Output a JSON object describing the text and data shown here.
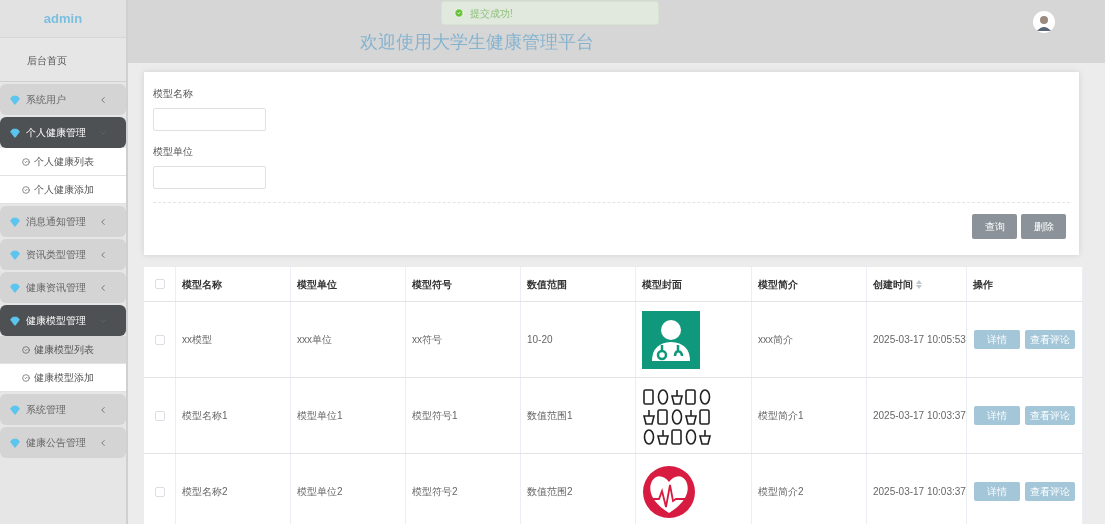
{
  "sidebar": {
    "brand": "admin",
    "home": "后台首页",
    "menus": [
      {
        "label": "系统用户",
        "expanded": false
      },
      {
        "label": "个人健康管理",
        "expanded": true,
        "children": [
          {
            "label": "个人健康列表",
            "selected": false
          },
          {
            "label": "个人健康添加",
            "selected": false
          }
        ]
      },
      {
        "label": "消息通知管理",
        "expanded": false
      },
      {
        "label": "资讯类型管理",
        "expanded": false
      },
      {
        "label": "健康资讯管理",
        "expanded": false
      },
      {
        "label": "健康模型管理",
        "expanded": true,
        "children": [
          {
            "label": "健康模型列表",
            "selected": true
          },
          {
            "label": "健康模型添加",
            "selected": false
          }
        ]
      },
      {
        "label": "系统管理",
        "expanded": false
      },
      {
        "label": "健康公告管理",
        "expanded": false
      }
    ]
  },
  "header": {
    "title": "欢迎使用大学生健康管理平台"
  },
  "toast": {
    "message": "提交成功!"
  },
  "search": {
    "fields": [
      {
        "label": "模型名称"
      },
      {
        "label": "模型单位"
      }
    ],
    "buttons": [
      "查询",
      "删除"
    ]
  },
  "table": {
    "all_checked": false,
    "columns": [
      {
        "label": "模型名称",
        "sortable": false
      },
      {
        "label": "模型单位",
        "sortable": false
      },
      {
        "label": "模型符号",
        "sortable": false
      },
      {
        "label": "数值范围",
        "sortable": false
      },
      {
        "label": "模型封面",
        "sortable": false
      },
      {
        "label": "模型简介",
        "sortable": false
      },
      {
        "label": "创建时间",
        "sortable": true
      },
      {
        "label": "操作",
        "sortable": false
      }
    ],
    "rows": [
      {
        "checked": false,
        "name": "xx模型",
        "unit": "xxx单位",
        "symbol": "xx符号",
        "range": "10-20",
        "cover": {
          "kind": "doctor"
        },
        "intro": "xxx简介",
        "created": "2025-03-17 10:05:53",
        "actions": [
          "详情",
          "查看评论"
        ]
      },
      {
        "checked": false,
        "name": "模型名称1",
        "unit": "模型单位1",
        "symbol": "模型符号1",
        "range": "数值范围1",
        "cover": {
          "kind": "icons"
        },
        "intro": "模型简介1",
        "created": "2025-03-17 10:03:37",
        "actions": [
          "详情",
          "查看评论"
        ]
      },
      {
        "checked": false,
        "name": "模型名称2",
        "unit": "模型单位2",
        "symbol": "模型符号2",
        "range": "数值范围2",
        "cover": {
          "kind": "heart"
        },
        "intro": "模型简介2",
        "created": "2025-03-17 10:03:37",
        "actions": [
          "详情",
          "查看评论"
        ]
      }
    ]
  }
}
